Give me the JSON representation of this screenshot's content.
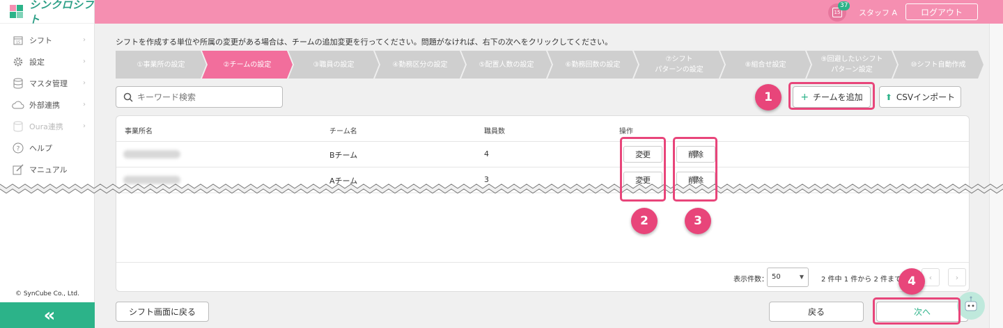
{
  "app": {
    "logo_text": "シンクロシフト"
  },
  "sidebar": {
    "items": [
      {
        "label": "シフト",
        "icon": "calendar-icon",
        "enabled": true
      },
      {
        "label": "設定",
        "icon": "gear-icon",
        "enabled": true
      },
      {
        "label": "マスタ管理",
        "icon": "database-icon",
        "enabled": true
      },
      {
        "label": "外部連携",
        "icon": "cloud-icon",
        "enabled": true
      },
      {
        "label": "Oura連携",
        "icon": "oura-icon",
        "enabled": false
      },
      {
        "label": "ヘルプ",
        "icon": "help-icon",
        "enabled": true
      },
      {
        "label": "マニュアル",
        "icon": "edit-icon",
        "enabled": true
      }
    ],
    "copyright": "© SynCube Co., Ltd.",
    "collapse_label": "«"
  },
  "header": {
    "calendar_day": "15",
    "notification_count": "37",
    "staff_name": "スタッフ A",
    "logout_label": "ログアウト",
    "accent_color": "#f58fb1"
  },
  "instruction": "シフトを作成する単位や所属の変更がある場合は、チームの追加変更を行ってください。問題がなければ、右下の次へをクリックしてください。",
  "steps": [
    {
      "label": "①事業所の設定",
      "active": false
    },
    {
      "label": "②チームの設定",
      "active": true
    },
    {
      "label": "③職員の設定",
      "active": false
    },
    {
      "label": "④勤務区分の設定",
      "active": false
    },
    {
      "label": "⑤配置人数の設定",
      "active": false
    },
    {
      "label": "⑥勤務回数の設定",
      "active": false
    },
    {
      "label": "⑦シフト\nパターンの設定",
      "active": false
    },
    {
      "label": "⑧組合せ設定",
      "active": false
    },
    {
      "label": "⑨回避したいシフト\nパターン設定",
      "active": false
    },
    {
      "label": "⑩シフト自動作成",
      "active": false
    }
  ],
  "search": {
    "placeholder": "キーワード検索"
  },
  "toolbar": {
    "add_team_label": "チームを追加",
    "csv_import_label": "CSVインポート"
  },
  "table": {
    "headers": [
      "事業所名",
      "チーム名",
      "職員数",
      "操作"
    ],
    "rows": [
      {
        "office": "",
        "team": "Bチーム",
        "staff_count": "4",
        "edit_label": "変更",
        "delete_label": "削除"
      },
      {
        "office": "",
        "team": "Aチーム",
        "staff_count": "3",
        "edit_label": "変更",
        "delete_label": "削除"
      }
    ]
  },
  "pagination": {
    "label": "表示件数：",
    "page_size": "50",
    "info": "2 件中 1 件から 2 件までを表示"
  },
  "footer": {
    "back_to_shift_label": "シフト画面に戻る",
    "back_label": "戻る",
    "next_label": "次へ"
  },
  "annotations": [
    "1",
    "2",
    "3",
    "4"
  ]
}
